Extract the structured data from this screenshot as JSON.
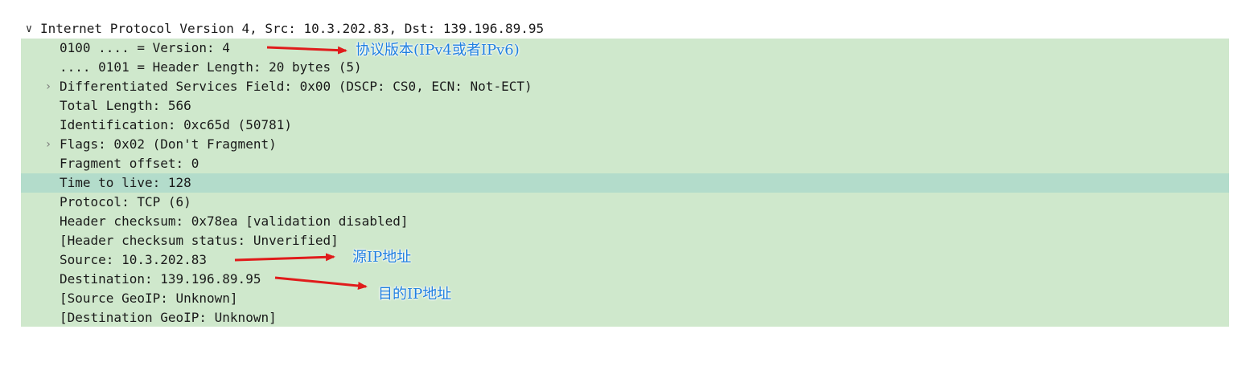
{
  "tree": {
    "header": {
      "label": "Internet Protocol Version 4, Src: 10.3.202.83, Dst: 139.196.89.95",
      "expanded_icon": "chevron-down-icon"
    },
    "rows": [
      {
        "label": "0100 .... = Version: 4",
        "expandable": false
      },
      {
        "label": ".... 0101 = Header Length: 20 bytes (5)",
        "expandable": false
      },
      {
        "label": "Differentiated Services Field: 0x00 (DSCP: CS0, ECN: Not-ECT)",
        "expandable": true,
        "icon": "chevron-right-icon"
      },
      {
        "label": "Total Length: 566",
        "expandable": false
      },
      {
        "label": "Identification: 0xc65d (50781)",
        "expandable": false
      },
      {
        "label": "Flags: 0x02 (Don't Fragment)",
        "expandable": true,
        "icon": "chevron-right-icon"
      },
      {
        "label": "Fragment offset: 0",
        "expandable": false
      },
      {
        "label": "Time to live: 128",
        "expandable": false,
        "selected": true
      },
      {
        "label": "Protocol: TCP (6)",
        "expandable": false
      },
      {
        "label": "Header checksum: 0x78ea [validation disabled]",
        "expandable": false
      },
      {
        "label": "[Header checksum status: Unverified]",
        "expandable": false
      },
      {
        "label": "Source: 10.3.202.83",
        "expandable": false
      },
      {
        "label": "Destination: 139.196.89.95",
        "expandable": false
      },
      {
        "label": "[Source GeoIP: Unknown]",
        "expandable": false
      },
      {
        "label": "[Destination GeoIP: Unknown]",
        "expandable": false
      }
    ]
  },
  "annotations": {
    "version": "协议版本(IPv4或者IPv6)",
    "source": "源IP地址",
    "destination": "目的IP地址"
  },
  "colors": {
    "panel_bg": "#cfe8cc",
    "selected_row_bg": "#b3dccb",
    "annotation_text": "#1f7fe0",
    "arrow": "#e01b1b"
  }
}
